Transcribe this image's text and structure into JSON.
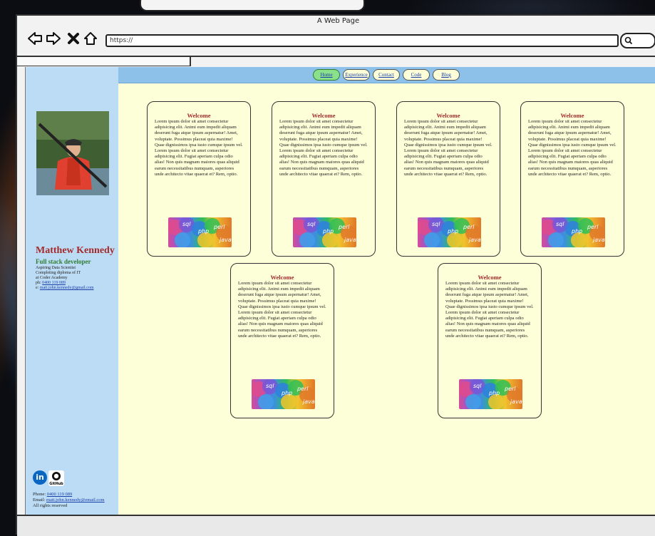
{
  "window": {
    "title": "A Web Page",
    "url": "https://"
  },
  "nav": {
    "items": [
      {
        "label": "Home",
        "active": true
      },
      {
        "label": "Experience",
        "active": false
      },
      {
        "label": "Contact",
        "active": false
      },
      {
        "label": "Code",
        "active": false
      },
      {
        "label": "Blog",
        "active": false
      }
    ]
  },
  "sidebar": {
    "name": "Matthew Kennedy",
    "role": "Full stack developer",
    "bio_lines": [
      "Aspiring Data Scientist",
      "Completing diploma of IT",
      "at Coder Academy"
    ],
    "ph_label": "ph:",
    "ph_value": "0400 119 089",
    "e_label": "e:",
    "e_value": "matt.john.kennedy@gmail.com",
    "github_label": "GitHub",
    "footer": {
      "phone_label": "Phone:",
      "phone_value": "0400 119 089",
      "email_label": "Email:",
      "email_value": "matt.john.kennedy@email.com",
      "rights": "All rights reserved"
    }
  },
  "cards": [
    {
      "title": "Welcome",
      "body": "Lorem ipsum dolor sit amet consectetur adipisicing elit. Animi eum impedit aliquam deserunt fuga atque ipsum aspernatur! Amet, voluptate. Possimus placeat quia maxime! Quae dignissimos ipsa iusto cumque ipsum vel. Lorem ipsum dolor sit amet consectetur adipisicing elit. Fugiat aperiam culpa odio alias! Non quis magnam maiores quas aliquid earum necessitatibus numquam, asperiores unde architecto vitae quaerat et? Rem, optio.",
      "image_labels": [
        "sql",
        "php",
        "perl",
        "java"
      ]
    },
    {
      "title": "Welcome",
      "body": "Lorem ipsum dolor sit amet consectetur adipisicing elit. Animi eum impedit aliquam deserunt fuga atque ipsum aspernatur! Amet, voluptate. Possimus placeat quia maxime! Quae dignissimos ipsa iusto cumque ipsum vel. Lorem ipsum dolor sit amet consectetur adipisicing elit. Fugiat aperiam culpa odio alias! Non quis magnam maiores quas aliquid earum necessitatibus numquam, asperiores unde architecto vitae quaerat et? Rem, optio.",
      "image_labels": [
        "sql",
        "php",
        "perl",
        "java"
      ]
    },
    {
      "title": "Welcome",
      "body": "Lorem ipsum dolor sit amet consectetur adipisicing elit. Animi eum impedit aliquam deserunt fuga atque ipsum aspernatur! Amet, voluptate. Possimus placeat quia maxime! Quae dignissimos ipsa iusto cumque ipsum vel. Lorem ipsum dolor sit amet consectetur adipisicing elit. Fugiat aperiam culpa odio alias! Non quis magnam maiores quas aliquid earum necessitatibus numquam, asperiores unde architecto vitae quaerat et? Rem, optio.",
      "image_labels": [
        "sql",
        "php",
        "perl",
        "java"
      ]
    },
    {
      "title": "Welcome",
      "body": "Lorem ipsum dolor sit amet consectetur adipisicing elit. Animi eum impedit aliquam deserunt fuga atque ipsum aspernatur! Amet, voluptate. Possimus placeat quia maxime! Quae dignissimos ipsa iusto cumque ipsum vel. Lorem ipsum dolor sit amet consectetur adipisicing elit. Fugiat aperiam culpa odio alias! Non quis magnam maiores quas aliquid earum necessitatibus numquam, asperiores unde architecto vitae quaerat et? Rem, optio.",
      "image_labels": [
        "sql",
        "php",
        "perl",
        "java"
      ]
    },
    {
      "title": "Welcome",
      "body": "Lorem ipsum dolor sit amet consectetur adipisicing elit. Animi eum impedit aliquam deserunt fuga atque ipsum aspernatur! Amet, voluptate. Possimus placeat quia maxime! Quae dignissimos ipsa iusto cumque ipsum vel. Lorem ipsum dolor sit amet consectetur adipisicing elit. Fugiat aperiam culpa odio alias! Non quis magnam maiores quas aliquid earum necessitatibus numquam, asperiores unde architecto vitae quaerat et? Rem, optio.",
      "image_labels": [
        "sql",
        "php",
        "perl",
        "java"
      ]
    },
    {
      "title": "Welcome",
      "body": "Lorem ipsum dolor sit amet consectetur adipisicing elit. Animi eum impedit aliquam deserunt fuga atque ipsum aspernatur! Amet, voluptate. Possimus placeat quia maxime! Quae dignissimos ipsa iusto cumque ipsum vel. Lorem ipsum dolor sit amet consectetur adipisicing elit. Fugiat aperiam culpa odio alias! Non quis magnam maiores quas aliquid earum necessitatibus numquam, asperiores unde architecto vitae quaerat et? Rem, optio.",
      "image_labels": [
        "sql",
        "php",
        "perl",
        "java"
      ]
    }
  ],
  "icons": {
    "back": "arrow-left-icon",
    "forward": "arrow-right-icon",
    "stop": "close-icon",
    "home": "home-icon",
    "search": "search-icon",
    "linkedin": "linkedin-icon",
    "github": "github-icon"
  },
  "colors": {
    "page_bg": "#fdffd8",
    "sidebar_bg": "#bcdcf5",
    "nav_bg": "#8ec1ea",
    "active_pill": "#8be08b",
    "heading": "#a52a2a",
    "role": "#2e7d32"
  }
}
